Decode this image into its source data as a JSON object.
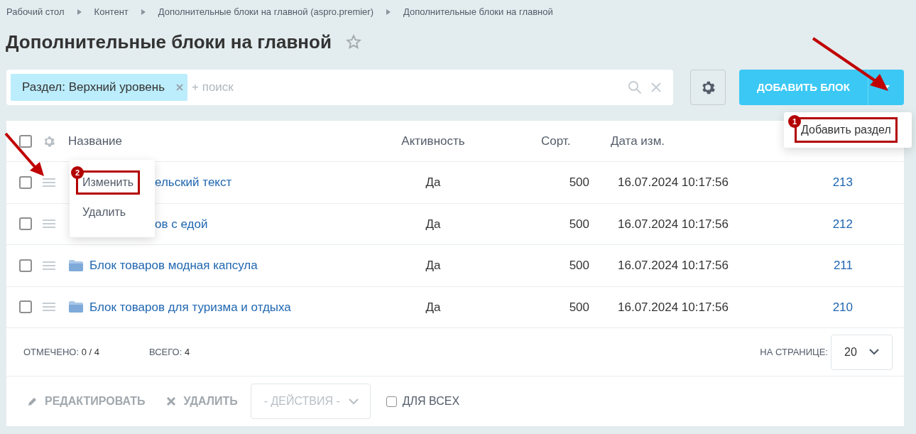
{
  "breadcrumbs": [
    "Рабочий стол",
    "Контент",
    "Дополнительные блоки на главной (aspro.premier)",
    "Дополнительные блоки на главной"
  ],
  "title": "Дополнительные блоки на главной",
  "filter": {
    "tag": "Раздел: Верхний уровень",
    "placeholder": "+ поиск"
  },
  "add_button": {
    "label": "ДОБАВИТЬ БЛОК"
  },
  "add_menu": {
    "items": [
      {
        "label": "Добавить раздел",
        "badge": "1",
        "highlighted": true
      }
    ]
  },
  "table": {
    "select_all": {
      "checked": false
    },
    "columns": [
      "Название",
      "Активность",
      "Сорт.",
      "Дата изм."
    ],
    "rows": [
      {
        "checked": false,
        "covered": true,
        "name": "ельский текст",
        "active": "Да",
        "sort": "500",
        "date": "16.07.2024 10:17:56",
        "id": "213"
      },
      {
        "checked": false,
        "covered": true,
        "name": "ов с едой",
        "active": "Да",
        "sort": "500",
        "date": "16.07.2024 10:17:56",
        "id": "212"
      },
      {
        "checked": false,
        "covered": false,
        "name": "Блок товаров модная капсула",
        "active": "Да",
        "sort": "500",
        "date": "16.07.2024 10:17:56",
        "id": "211"
      },
      {
        "checked": false,
        "covered": false,
        "name": "Блок товаров для туризма и отдыха",
        "active": "Да",
        "sort": "500",
        "date": "16.07.2024 10:17:56",
        "id": "210"
      }
    ]
  },
  "row_menu": {
    "items": [
      {
        "label": "Изменить",
        "badge": "2",
        "highlighted": true
      },
      {
        "label": "Удалить",
        "highlighted": false
      }
    ]
  },
  "footer": {
    "checked_label": "ОТМЕЧЕНО:",
    "checked_value": "0 / 4",
    "total_label": "ВСЕГО:",
    "total_value": "4",
    "per_page_label": "НА СТРАНИЦЕ:",
    "per_page": "20"
  },
  "actions": {
    "edit": "РЕДАКТИРОВАТЬ",
    "delete": "УДАЛИТЬ",
    "select": "- ДЕЙСТВИЯ -",
    "for_all": {
      "label": "ДЛЯ ВСЕХ",
      "checked": false
    }
  }
}
